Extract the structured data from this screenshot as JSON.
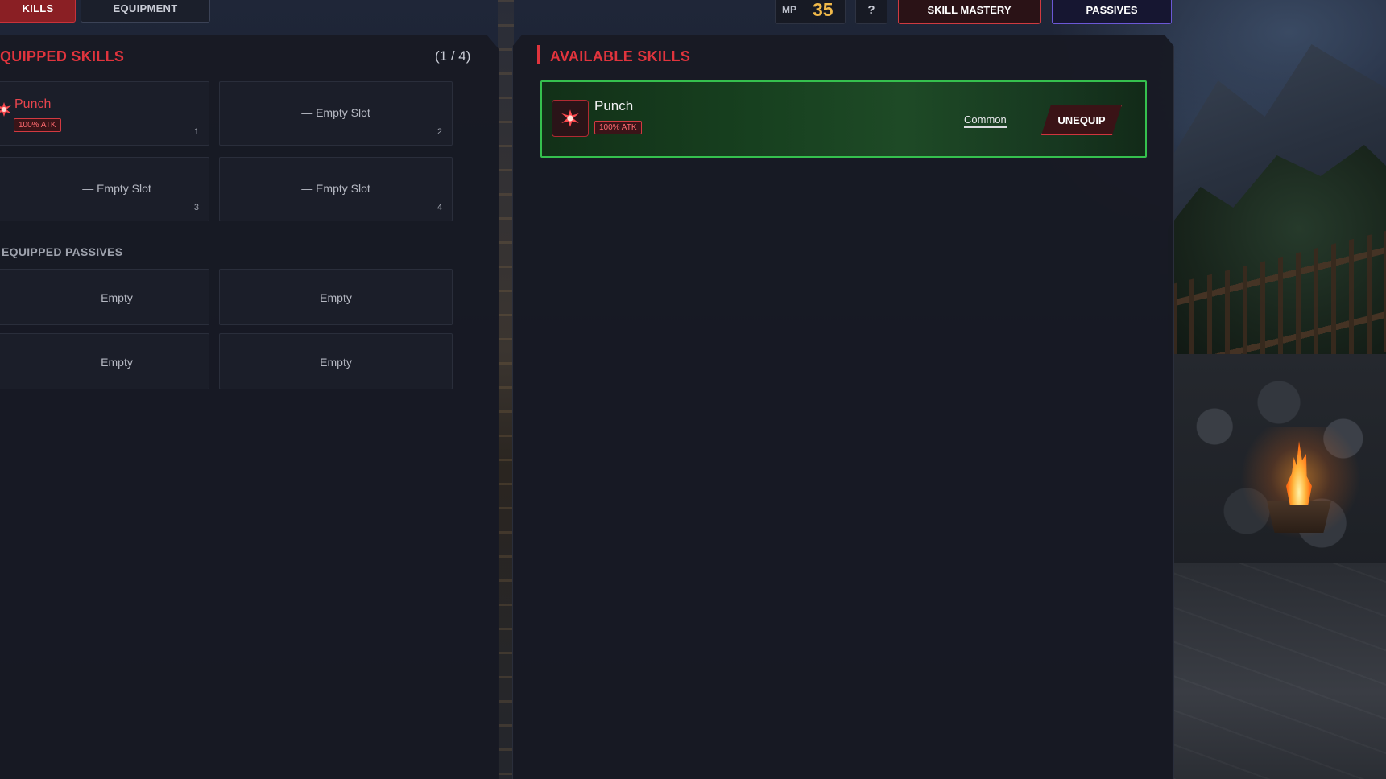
{
  "top_tabs": {
    "skills_label": "KILLS",
    "equipment_label": "EQUIPMENT"
  },
  "resources": {
    "mp_label": "MP",
    "mp_value": "35",
    "help_label": "?"
  },
  "top_buttons": {
    "skill_mastery_label": "SKILL MASTERY",
    "passives_label": "PASSIVES"
  },
  "equipped": {
    "title": "QUIPPED SKILLS",
    "count": "(1 / 4)",
    "slots": [
      {
        "name": "Punch",
        "badge": "100% ATK",
        "number": "1",
        "icon": "burst-icon"
      },
      {
        "label": "— Empty Slot",
        "number": "2"
      },
      {
        "label": "— Empty Slot",
        "number": "3"
      },
      {
        "label": "— Empty Slot",
        "number": "4"
      }
    ]
  },
  "passives": {
    "title": "EQUIPPED PASSIVES",
    "slots": [
      "Empty",
      "Empty",
      "Empty",
      "Empty"
    ]
  },
  "available": {
    "title": "AVAILABLE SKILLS",
    "skills": [
      {
        "name": "Punch",
        "badge": "100% ATK",
        "rarity": "Common",
        "action_label": "UNEQUIP",
        "icon": "burst-icon"
      }
    ]
  },
  "colors": {
    "accent_red": "#e0343d",
    "mp_gold": "#f0b94a",
    "selected_green": "#35c04e",
    "passives_purple": "#6b58d6"
  }
}
